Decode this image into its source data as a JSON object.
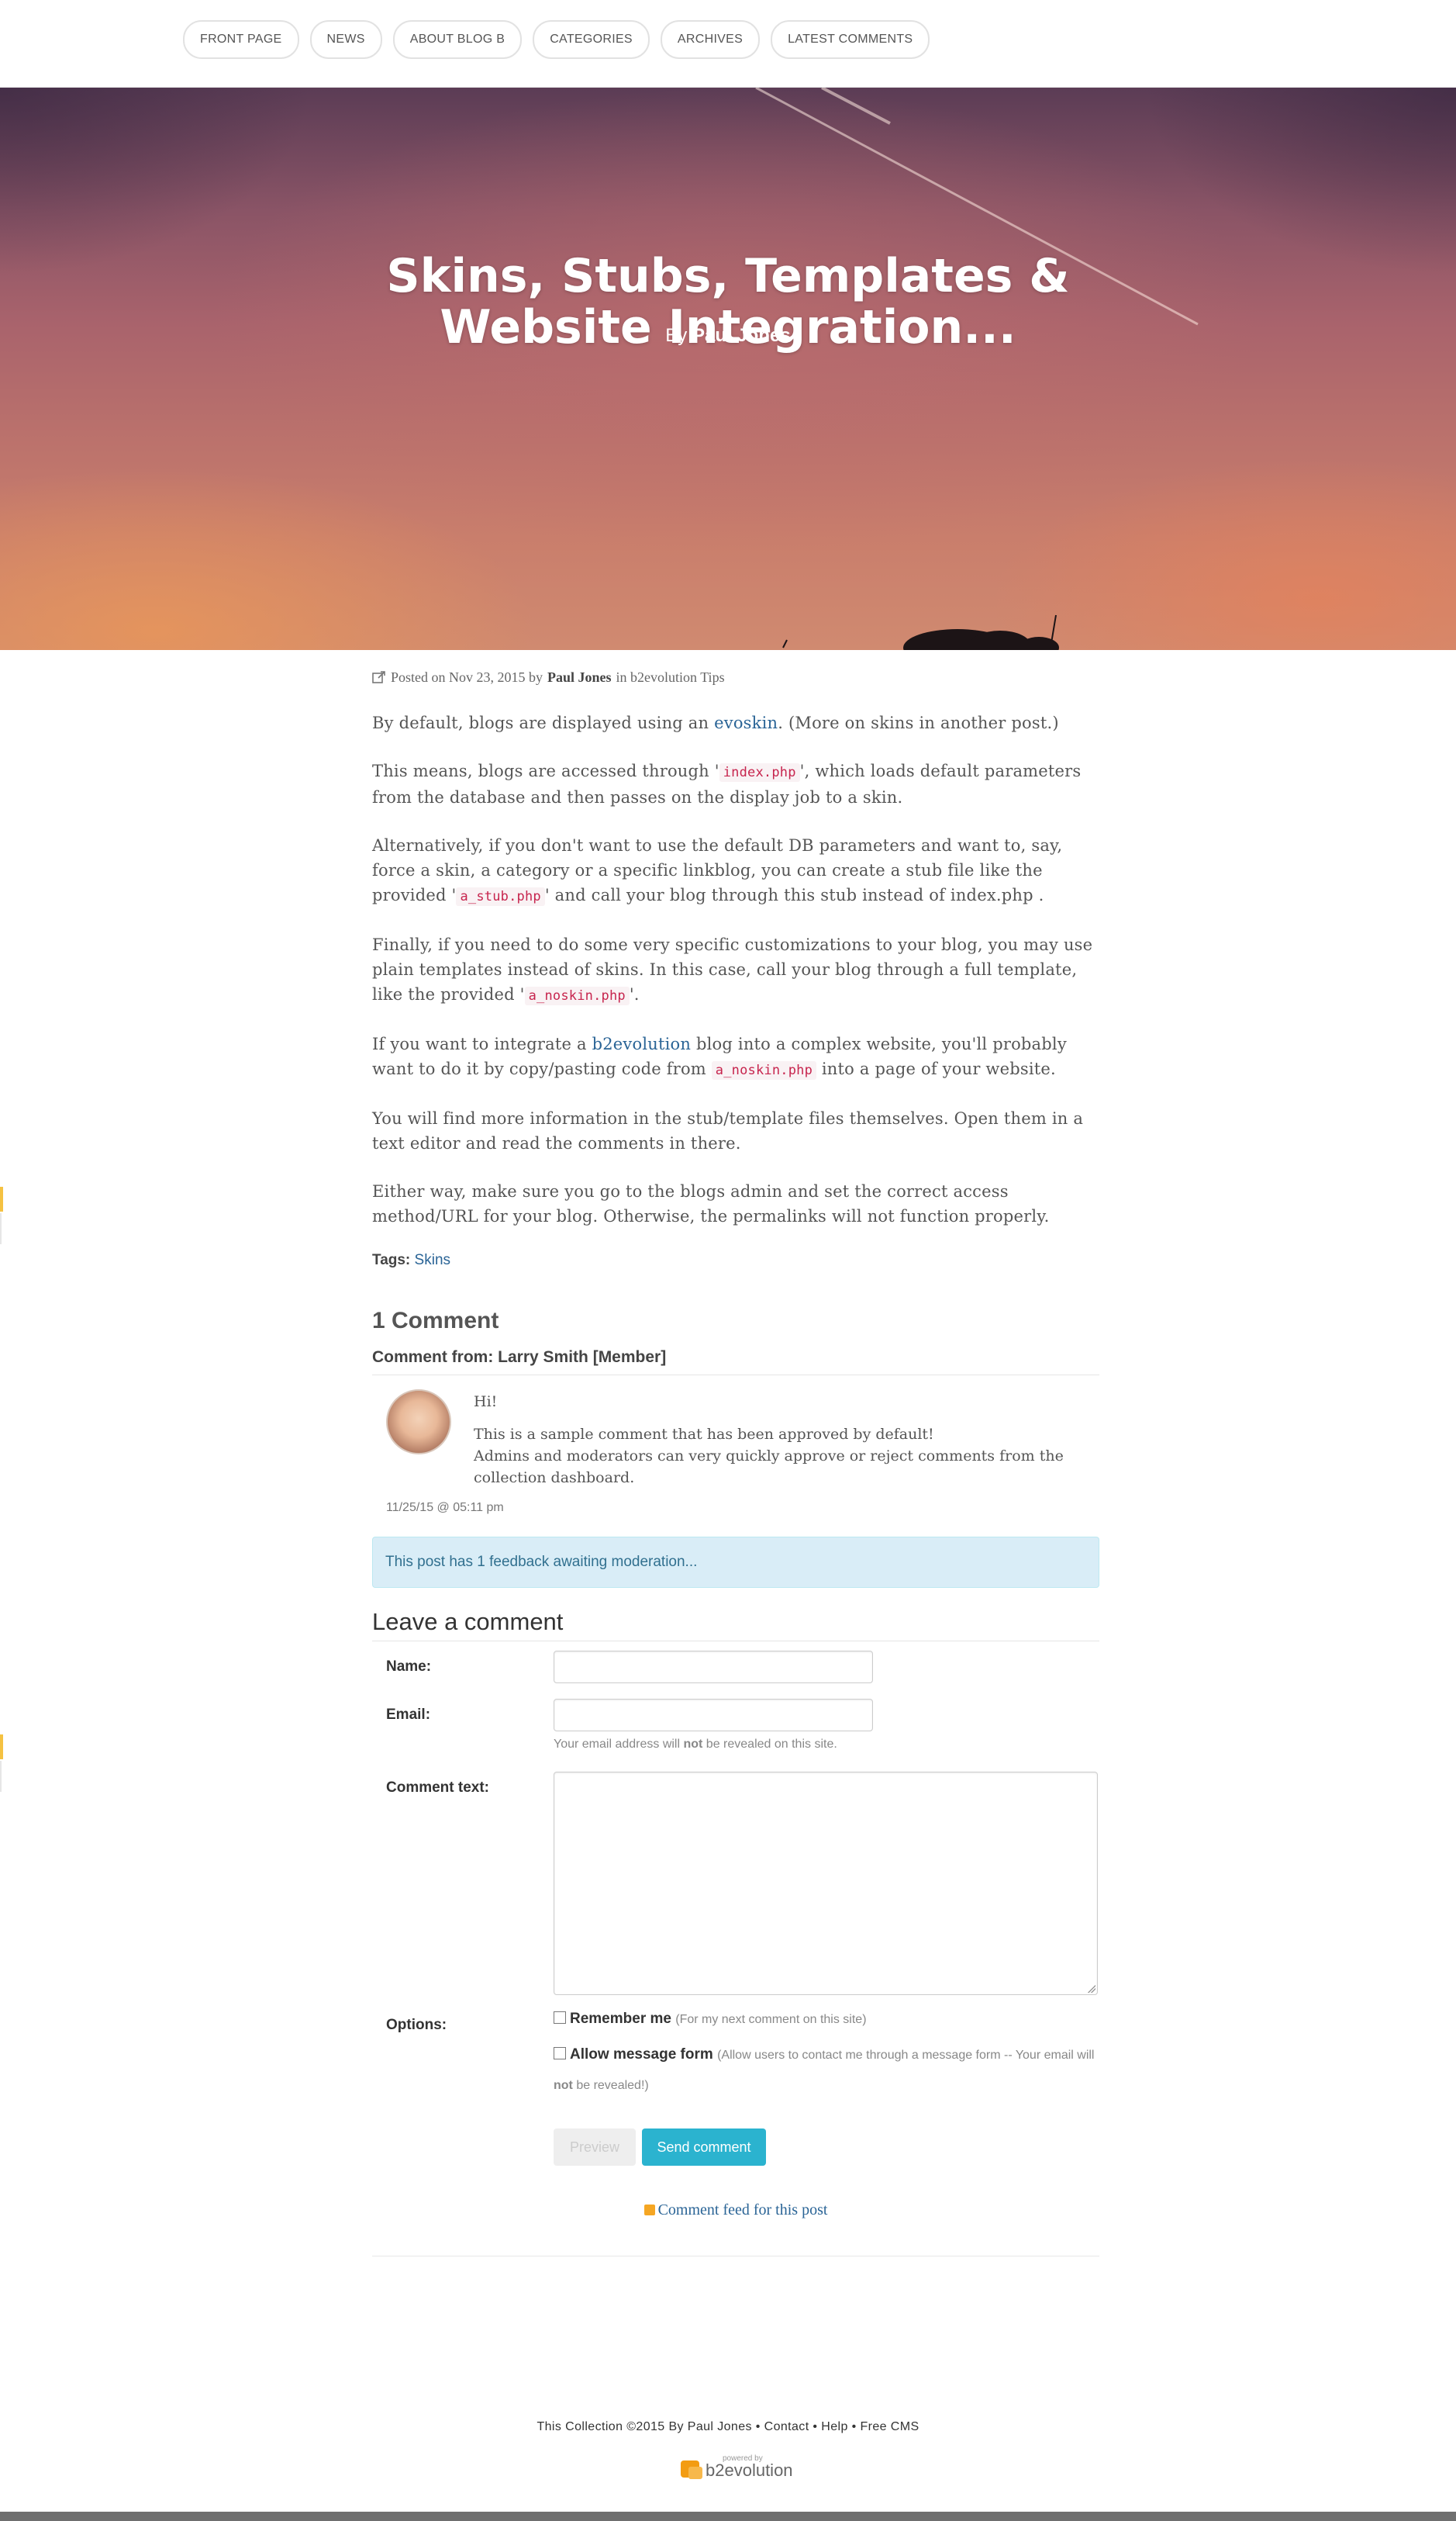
{
  "nav": {
    "items": [
      "FRONT PAGE",
      "NEWS",
      "ABOUT BLOG B",
      "CATEGORIES",
      "ARCHIVES",
      "LATEST COMMENTS"
    ]
  },
  "hero": {
    "title": "Skins, Stubs, Templates & Website Integration...",
    "by_prefix": "By",
    "author": "Paul Jones"
  },
  "meta": {
    "icon": "external-link-icon",
    "posted_on": "Posted on Nov 23, 2015 by",
    "author": "Paul Jones",
    "in_text": "in b2evolution Tips"
  },
  "post": {
    "p1_a": "By default, blogs are displayed using an ",
    "p1_link": "evoskin",
    "p1_b": ". (More on skins in another post.)",
    "p2_a": "This means, blogs are accessed through '",
    "p2_code": "index.php",
    "p2_b": "', which loads default parameters from the database and then passes on the display job to a skin.",
    "p3_a": "Alternatively, if you don't want to use the default DB parameters and want to, say, force a skin, a category or a specific linkblog, you can create a stub file like the provided '",
    "p3_code": "a_stub.php",
    "p3_b": "' and call your blog through this stub instead of index.php .",
    "p4_a": "Finally, if you need to do some very specific customizations to your blog, you may use plain templates instead of skins. In this case, call your blog through a full template, like the provided '",
    "p4_code": "a_noskin.php",
    "p4_b": "'.",
    "p5_a": "If you want to integrate a ",
    "p5_link": "b2evolution",
    "p5_b": " blog into a complex website, you'll probably want to do it by copy/pasting code from ",
    "p5_code": "a_noskin.php",
    "p5_c": " into a page of your website.",
    "p6": "You will find more information in the stub/template files themselves. Open them in a text editor and read the comments in there.",
    "p7": "Either way, make sure you go to the blogs admin and set the correct access method/URL for your blog. Otherwise, the permalinks will not function properly."
  },
  "tags": {
    "label": "Tags:",
    "items": [
      "Skins"
    ]
  },
  "comments": {
    "title": "1 Comment",
    "from": "Comment from: Larry Smith [Member]",
    "line1": "Hi!",
    "line2": "This is a sample comment that has been approved by default!",
    "line3": "Admins and moderators can very quickly approve or reject comments from the collection dashboard.",
    "date": "11/25/15 @ 05:11 pm"
  },
  "alert": {
    "text": "This post has 1 feedback awaiting moderation..."
  },
  "form": {
    "title": "Leave a comment",
    "name_label": "Name:",
    "name_value": "",
    "email_label": "Email:",
    "email_value": "",
    "email_hint_a": "Your email address will ",
    "email_hint_b": "not",
    "email_hint_c": " be revealed on this site.",
    "text_label": "Comment text:",
    "options_label": "Options:",
    "remember_label": "Remember me",
    "remember_note": "(For my next comment on this site)",
    "allow_label": "Allow message form",
    "allow_note_a": "(Allow users to contact me through a message form -- Your email will",
    "allow_note_b": "not",
    "allow_note_c": " be revealed!)",
    "preview_btn": "Preview",
    "send_btn": "Send comment"
  },
  "feed": {
    "icon": "rss-icon",
    "label": "Comment feed for this post"
  },
  "footer": {
    "text": "This Collection ©2015 By Paul Jones • Contact • Help • Free CMS",
    "powered_by": "powered by",
    "brand": "b2evolution"
  },
  "colors": {
    "accent_button": "#2bb3cf",
    "link": "#2a6496",
    "alert_bg": "#d9edf7",
    "code": "#c7254e"
  }
}
